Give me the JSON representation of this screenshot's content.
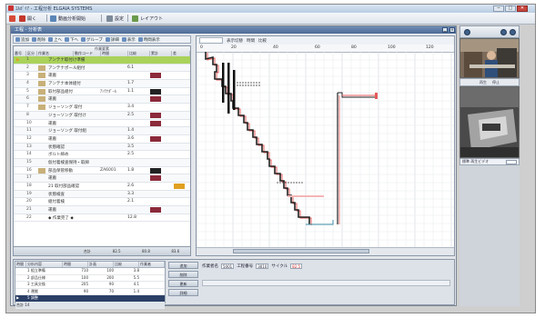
{
  "window": {
    "title": "ｴﾙｶﾞｲｱ - 工程分析 ELGAIA SYSTEMS",
    "min_label": "─",
    "max_label": "□",
    "close_label": "✕"
  },
  "toolbar": {
    "items": [
      {
        "label": "開く",
        "icon": "open-icon",
        "color": "#d64a3a"
      },
      {
        "label": "保存",
        "icon": "save-icon",
        "color": "#c4372c"
      },
      {
        "label": "動画分析開始",
        "icon": "video-analysis-icon",
        "color": "#5a86b8"
      },
      {
        "label": "設定",
        "icon": "settings-icon",
        "color": "#7d8a99"
      },
      {
        "label": "レイアウト",
        "icon": "layout-icon",
        "color": "#6b9a4a"
      }
    ]
  },
  "main": {
    "title": "工程 - 分析表",
    "left_toolbar": [
      {
        "label": "追加",
        "icon": "add-icon"
      },
      {
        "label": "削除",
        "icon": "delete-icon"
      },
      {
        "label": "上へ",
        "icon": "up-icon"
      },
      {
        "label": "下へ",
        "icon": "down-icon"
      },
      {
        "label": "グループ",
        "icon": "group-icon"
      },
      {
        "label": "詳細",
        "icon": "detail-icon"
      },
      {
        "label": "表示",
        "icon": "view-icon"
      },
      {
        "label": "時間表示",
        "icon": "time-icon"
      }
    ],
    "table_super_header": "作業要素",
    "table_columns": [
      "番号",
      "区分",
      "作業名",
      "動作コード",
      "時間",
      "比較",
      "累計",
      "差"
    ],
    "rows": [
      {
        "no": "1",
        "name": "アンテナ取付け準備",
        "code": "",
        "val": "",
        "marker": false,
        "swatch": "",
        "highlight": true,
        "indent": 0
      },
      {
        "no": "2",
        "name": "アンテナポール組付",
        "code": "",
        "val": "6.1",
        "marker": true,
        "swatch": "",
        "highlight": false,
        "indent": 0
      },
      {
        "no": "3",
        "name": "運搬",
        "code": "",
        "val": "",
        "marker": true,
        "swatch": "#8b2a3a",
        "highlight": false,
        "indent": 0
      },
      {
        "no": "4",
        "name": "アンテナ本体組付",
        "code": "",
        "val": "1.7",
        "marker": true,
        "swatch": "",
        "highlight": false,
        "indent": 0
      },
      {
        "no": "5",
        "name": "取付部品組付",
        "code": "ｱﾝﾃﾅﾎﾟｰﾙ",
        "val": "1.1",
        "marker": true,
        "swatch": "#222222",
        "highlight": false,
        "indent": 0
      },
      {
        "no": "6",
        "name": "運搬",
        "code": "",
        "val": "",
        "marker": true,
        "swatch": "#8b2a3a",
        "highlight": false,
        "indent": 0
      },
      {
        "no": "7",
        "name": "ジョーソング 取付",
        "code": "",
        "val": "3.4",
        "marker": true,
        "swatch": "",
        "highlight": false,
        "indent": 0
      },
      {
        "no": "8",
        "name": "ジョーソング 取付け",
        "code": "",
        "val": "2.5",
        "marker": false,
        "swatch": "#8b2a3a",
        "highlight": false,
        "indent": 0
      },
      {
        "no": "10",
        "name": "運搬",
        "code": "",
        "val": "",
        "marker": false,
        "swatch": "#8b2a3a",
        "highlight": false,
        "indent": 0
      },
      {
        "no": "11",
        "name": "ジョーソング 取付組",
        "code": "",
        "val": "1.4",
        "marker": false,
        "swatch": "",
        "highlight": false,
        "indent": 0
      },
      {
        "no": "12",
        "name": "運搬",
        "code": "",
        "val": "3.6",
        "marker": false,
        "swatch": "#8b2a3a",
        "highlight": false,
        "indent": 0
      },
      {
        "no": "13",
        "name": "状態確認",
        "code": "",
        "val": "3.5",
        "marker": false,
        "swatch": "",
        "highlight": false,
        "indent": 0
      },
      {
        "no": "14",
        "name": "ボルト締め",
        "code": "",
        "val": "2.5",
        "marker": false,
        "swatch": "",
        "highlight": false,
        "indent": 0
      },
      {
        "no": "15",
        "name": "仮付着検査保持・取締",
        "code": "",
        "val": "",
        "marker": false,
        "swatch": "",
        "highlight": false,
        "indent": 0
      },
      {
        "no": "16",
        "name": "部品保管移動",
        "code": "ZA6001",
        "val": "1.8",
        "marker": true,
        "swatch": "#222222",
        "highlight": false,
        "indent": 0
      },
      {
        "no": "17",
        "name": "運搬",
        "code": "",
        "val": "",
        "marker": false,
        "swatch": "#8b2a3a",
        "highlight": false,
        "indent": 0
      },
      {
        "no": "18",
        "name": "21 取付部品確認",
        "code": "",
        "val": "2.6",
        "marker": false,
        "swatch": "",
        "highlight": false,
        "indent": 0
      },
      {
        "no": "19",
        "name": "状態検査",
        "code": "",
        "val": "3.3",
        "marker": false,
        "swatch": "",
        "highlight": false,
        "indent": 0
      },
      {
        "no": "20",
        "name": "組付着検",
        "code": "",
        "val": "2.1",
        "marker": false,
        "swatch": "",
        "highlight": false,
        "indent": 0
      },
      {
        "no": "21",
        "name": "運搬",
        "code": "",
        "val": "",
        "marker": false,
        "swatch": "#8b2a3a",
        "highlight": false,
        "indent": 0
      },
      {
        "no": "22",
        "name": "◆ 作業完了 ◆",
        "code": "",
        "val": "12.8",
        "marker": false,
        "swatch": "",
        "highlight": false,
        "indent": 0
      }
    ],
    "table_footer": [
      "",
      "",
      "合計",
      "82.5",
      "80.8",
      "83.6"
    ],
    "chart_toolbar": [
      "表示切替",
      "時間",
      "比較"
    ],
    "ruler_ticks": [
      "0",
      "20",
      "40",
      "60",
      "80",
      "100",
      "120"
    ]
  },
  "bottom": {
    "columns": [
      "時間",
      "分析内容",
      "時間",
      "計画",
      "比較",
      "作業者"
    ],
    "rows": [
      {
        "cells": [
          "1 組立準備",
          "710",
          "100",
          "3.8"
        ],
        "selected": false
      },
      {
        "cells": [
          "2 部品仕様",
          "100",
          "200",
          "5.5"
        ],
        "selected": false
      },
      {
        "cells": [
          "3 工具交換",
          "205",
          "90",
          "4.1"
        ],
        "selected": false
      },
      {
        "cells": [
          "4 運搬",
          "90",
          "70",
          "1.4"
        ],
        "selected": false
      },
      {
        "cells": [
          "5 調整",
          "",
          "",
          ""
        ],
        "selected": true
      }
    ],
    "footer": "合計 14",
    "buttons": [
      "追加",
      "削除",
      "更新",
      "詳細"
    ],
    "fields": [
      {
        "label": "作業者名",
        "value": "5001",
        "red": false
      },
      {
        "label": "工程番号",
        "value": "3010",
        "red": false
      },
      {
        "label": "サイクル",
        "value": "82.5",
        "red": true
      }
    ]
  },
  "right_pane": {
    "toolbar_labels": [
      "再生",
      "停止"
    ],
    "bottom_label": "標準 再生ビデオ"
  },
  "colors": {
    "highlight_row": "#a9d25a",
    "accent_red": "#c22a2a",
    "selection_blue": "#2b3f66"
  }
}
